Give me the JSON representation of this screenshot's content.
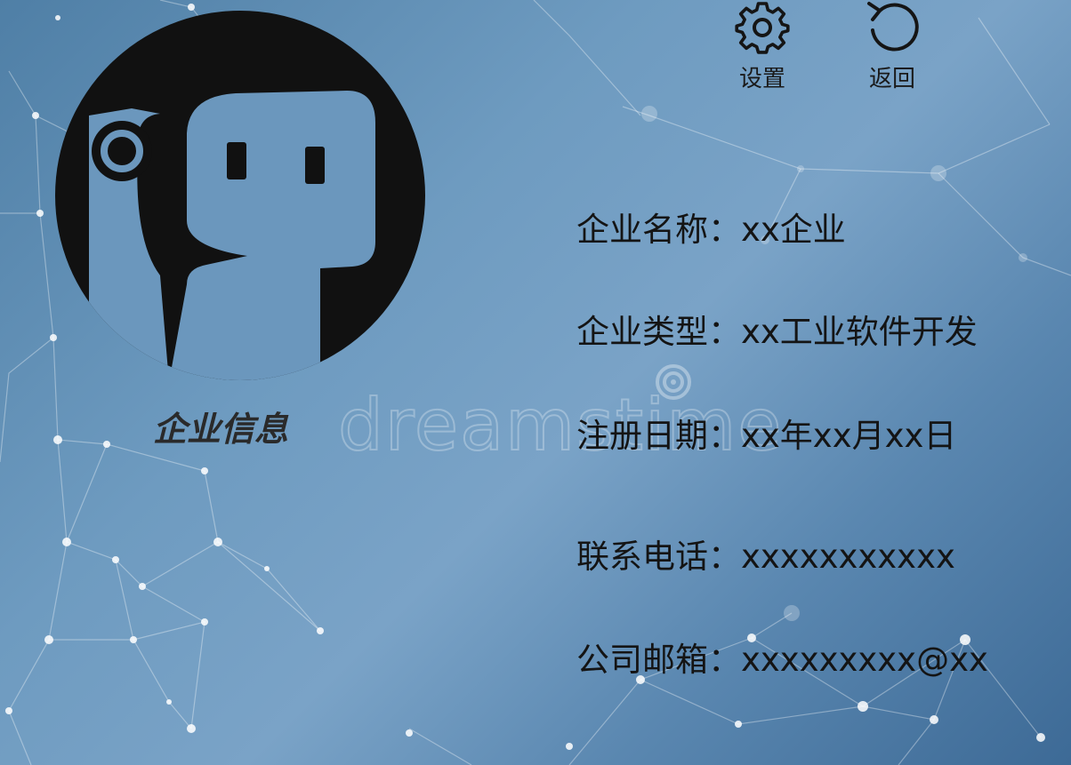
{
  "header": {
    "settings_label": "设置",
    "back_label": "返回"
  },
  "profile": {
    "title": "企业信息"
  },
  "watermark": {
    "text": "dreamstime"
  },
  "info": [
    {
      "label": "企业名称：",
      "value": "xx企业"
    },
    {
      "label": "企业类型：",
      "value": "xx工业软件开发"
    },
    {
      "label": "注册日期：",
      "value": "xx年xx月xx日"
    },
    {
      "label": "联系电话：",
      "value": "xxxxxxxxxxx"
    },
    {
      "label": "公司邮箱：",
      "value": "xxxxxxxxx@xx"
    }
  ],
  "colors": {
    "text": "#141414",
    "background_light": "#7aa3c7",
    "background_dark": "#3d6a96",
    "avatar": "#111111"
  },
  "icons": {
    "settings": "gear-icon",
    "back": "rotate-ccw-icon",
    "avatar": "robot-avatar-icon"
  }
}
